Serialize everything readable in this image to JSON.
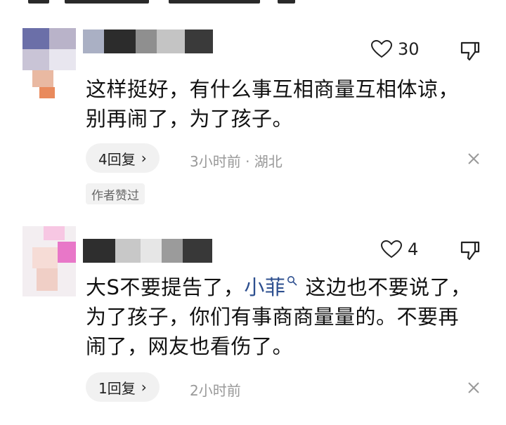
{
  "comments": [
    {
      "likes": "30",
      "text": "这样挺好，有什么事互相商量互相体谅，别再闹了，为了孩子。",
      "reply_label": "4回复",
      "chevron": "›",
      "meta": "3小时前 · 湖北",
      "author_tag": "作者赞过"
    },
    {
      "likes": "4",
      "text_before": "大S不要提告了，",
      "mention": "小菲",
      "text_after": "这边也不要说了，为了孩子，你们有事商商量量的。不要再闹了，网友也看伤了。",
      "reply_label": "1回复",
      "chevron": "›",
      "meta": "2小时前"
    }
  ],
  "icons": {
    "like": "heart-outline-icon",
    "dislike": "thumbs-down-icon",
    "close": "close-icon",
    "mention_search": "search-icon"
  },
  "colors": {
    "mention": "#2d4f8f",
    "meta": "#999999",
    "pill_bg": "#f1f1f1"
  }
}
